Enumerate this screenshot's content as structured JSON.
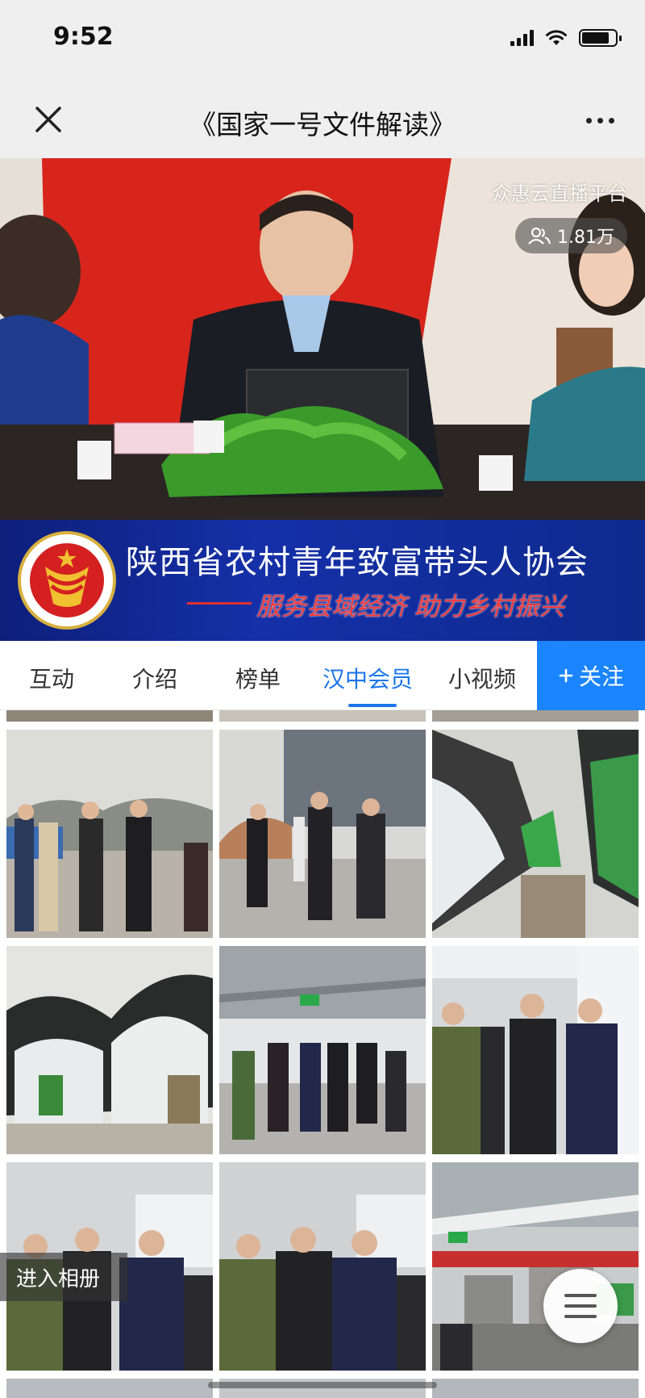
{
  "status_bar": {
    "time": "9:52"
  },
  "nav": {
    "title": "《国家一号文件解读》"
  },
  "video": {
    "watermark": "众惠云直播平台",
    "viewer_count": "1.81万"
  },
  "banner": {
    "title": "陕西省农村青年致富带头人协会",
    "slogan": "服务县域经济 助力乡村振兴"
  },
  "tabs": [
    {
      "label": "互动",
      "active": false
    },
    {
      "label": "介绍",
      "active": false
    },
    {
      "label": "榜单",
      "active": false
    },
    {
      "label": "汉中会员",
      "active": true
    },
    {
      "label": "小视频",
      "active": false
    }
  ],
  "follow_button": {
    "label": "关注",
    "icon": "plus-icon"
  },
  "album_button": {
    "label": "进入相册"
  },
  "colors": {
    "accent": "#1a75e8",
    "follow_bg": "#1a85ff",
    "banner_bg": "#1530a8",
    "slogan": "#f03a3a"
  }
}
